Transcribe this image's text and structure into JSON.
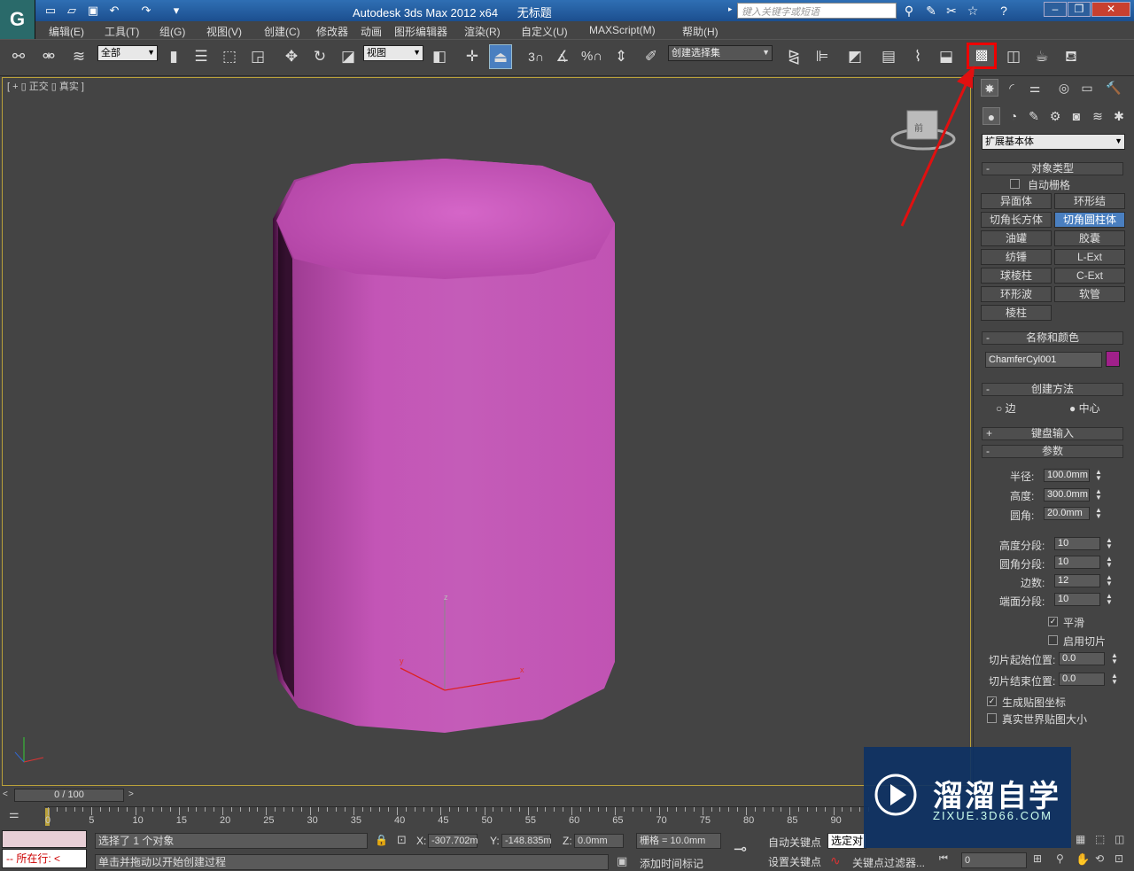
{
  "app": {
    "title": "Autodesk 3ds Max  2012 x64",
    "doc_title": "无标题",
    "search_placeholder": "键入关键字或短语"
  },
  "menu": [
    "编辑(E)",
    "工具(T)",
    "组(G)",
    "视图(V)",
    "创建(C)",
    "修改器",
    "动画",
    "图形编辑器",
    "渲染(R)",
    "自定义(U)",
    "MAXScript(M)",
    "帮助(H)"
  ],
  "toolbar": {
    "selection_filter": "全部",
    "reference_coord": "视图",
    "named_selection": "创建选择集",
    "snap_3": "3",
    "percent": "%"
  },
  "viewport": {
    "label": "[ + ▯ 正交 ▯ 真实 ]",
    "object_color": "#c050b0",
    "border_color": "#bba23a",
    "gizmo_axes": [
      "x",
      "y",
      "z"
    ]
  },
  "panel": {
    "category": "扩展基本体",
    "object_type": {
      "title": "对象类型",
      "autogrid_label": "自动栅格",
      "buttons": [
        "异面体",
        "环形结",
        "切角长方体",
        "切角圆柱体",
        "油罐",
        "胶囊",
        "纺锤",
        "L-Ext",
        "球棱柱",
        "C-Ext",
        "环形波",
        "软管",
        "棱柱"
      ],
      "selected": "切角圆柱体"
    },
    "name_color": {
      "title": "名称和颜色",
      "name": "ChamferCyl001",
      "color": "#a0208a"
    },
    "creation_method": {
      "title": "创建方法",
      "options": [
        "边",
        "中心"
      ],
      "selected": "中心"
    },
    "keyboard_entry": {
      "title": "键盘输入"
    },
    "parameters": {
      "title": "参数",
      "radius_label": "半径:",
      "radius": "100.0mm",
      "height_label": "高度:",
      "height": "300.0mm",
      "fillet_label": "圆角:",
      "fillet": "20.0mm",
      "height_segs_label": "高度分段:",
      "height_segs": "10",
      "fillet_segs_label": "圆角分段:",
      "fillet_segs": "10",
      "sides_label": "边数:",
      "sides": "12",
      "cap_segs_label": "端面分段:",
      "cap_segs": "10",
      "smooth_label": "平滑",
      "smooth": true,
      "slice_on_label": "启用切片",
      "slice_on": false,
      "slice_from_label": "切片起始位置:",
      "slice_from": "0.0",
      "slice_to_label": "切片结束位置:",
      "slice_to": "0.0",
      "gen_uv_label": "生成贴图坐标",
      "gen_uv": true,
      "real_world_label": "真实世界贴图大小",
      "real_world": false
    }
  },
  "timeline": {
    "frame": "0 / 100",
    "ticks": [
      "0",
      "5",
      "10",
      "15",
      "20",
      "25",
      "30",
      "35",
      "40",
      "45",
      "50",
      "55",
      "60",
      "65",
      "70",
      "75",
      "80",
      "85",
      "90"
    ]
  },
  "status": {
    "selection": "选择了 1 个对象",
    "prompt": "单击并拖动以开始创建过程",
    "x_label": "X:",
    "x": "-307.702m",
    "y_label": "Y:",
    "y": "-148.835m",
    "z_label": "Z:",
    "z": "0.0mm",
    "grid": "栅格 = 10.0mm",
    "auto_key": "自动关键点",
    "set_key": "设置关键点",
    "selected_obj": "选定对",
    "key_filters": "关键点过滤器...",
    "add_time_tag": "添加时间标记",
    "frame_field": "0",
    "script_label": "所在行:"
  },
  "watermark": {
    "name": "溜溜自学",
    "url": "ZIXUE.3D66.COM"
  }
}
